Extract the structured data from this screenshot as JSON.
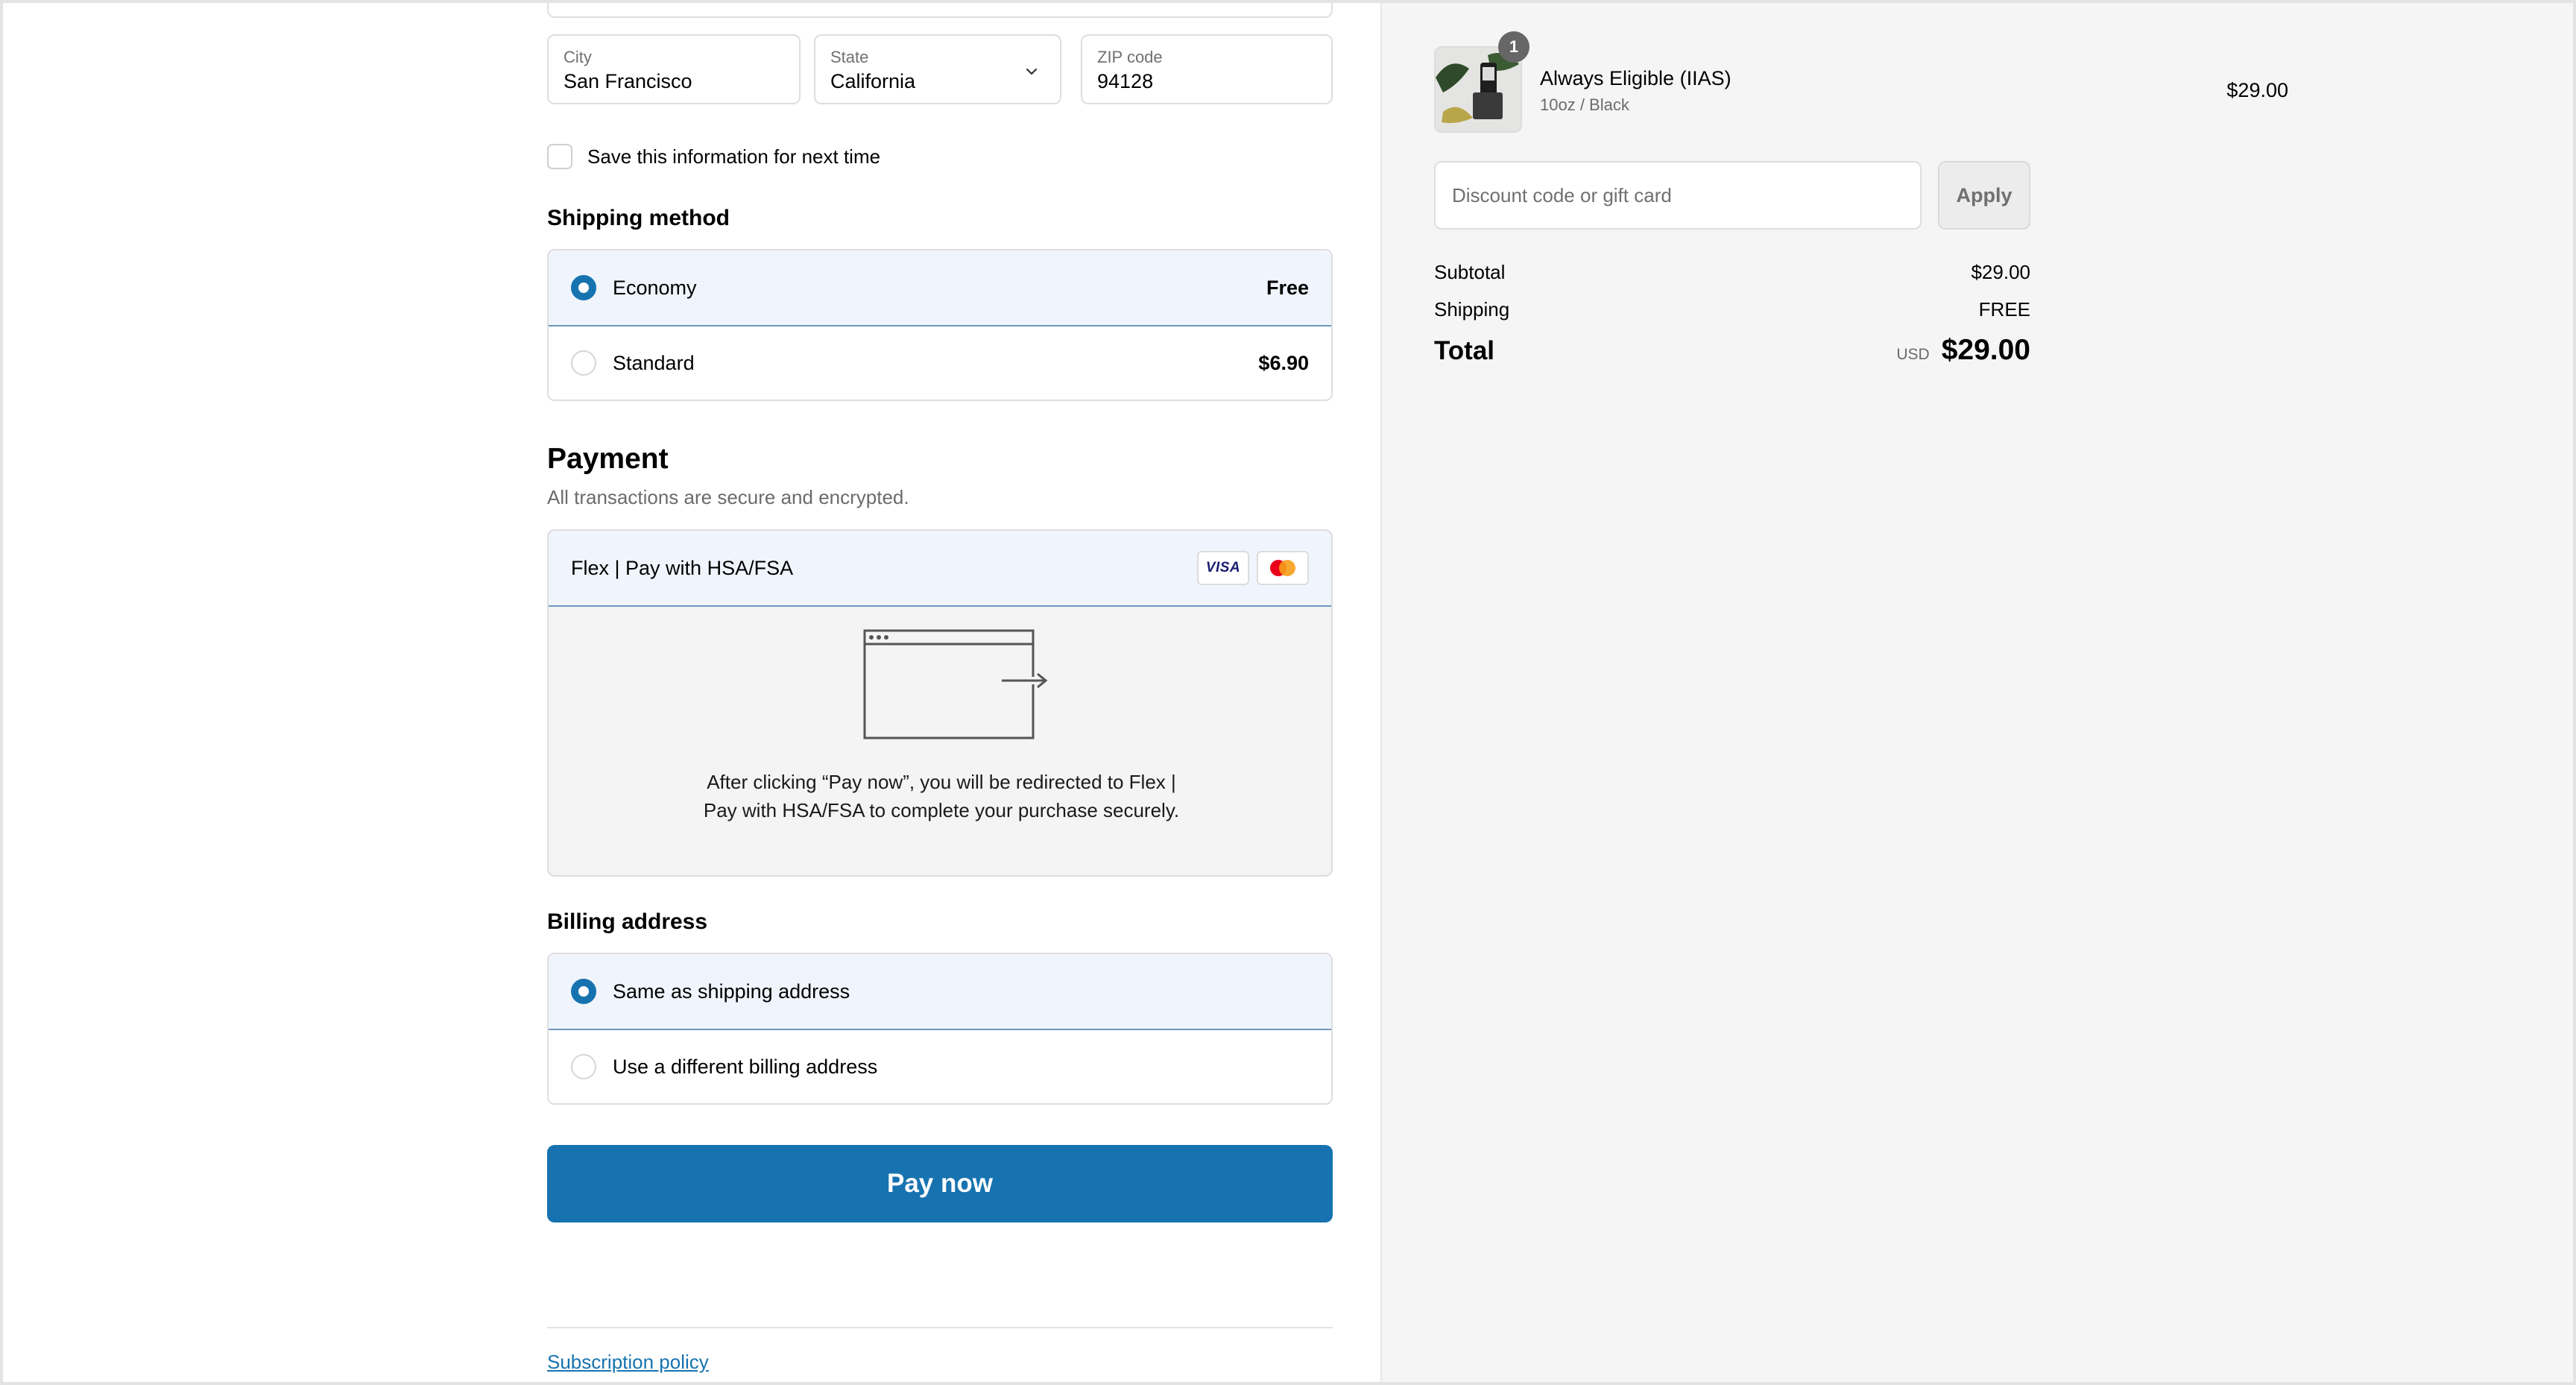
{
  "address": {
    "city": {
      "label": "City",
      "value": "San Francisco"
    },
    "state": {
      "label": "State",
      "value": "California"
    },
    "zip": {
      "label": "ZIP code",
      "value": "94128"
    },
    "save_label": "Save this information for next time"
  },
  "shipping": {
    "title": "Shipping method",
    "options": [
      {
        "label": "Economy",
        "price": "Free",
        "selected": true
      },
      {
        "label": "Standard",
        "price": "$6.90",
        "selected": false
      }
    ]
  },
  "payment": {
    "title": "Payment",
    "subtitle": "All transactions are secure and encrypted.",
    "method": "Flex | Pay with HSA/FSA",
    "visa": "VISA",
    "redirect_text": "After clicking “Pay now”, you will be redirected to Flex | Pay with HSA/FSA to complete your purchase securely."
  },
  "billing": {
    "title": "Billing address",
    "options": [
      {
        "label": "Same as shipping address",
        "selected": true
      },
      {
        "label": "Use a different billing address",
        "selected": false
      }
    ]
  },
  "pay_button": "Pay now",
  "footer": {
    "policy_link": "Subscription policy"
  },
  "summary": {
    "product": {
      "qty": "1",
      "name": "Always Eligible (IIAS)",
      "variant": "10oz / Black",
      "price": "$29.00"
    },
    "discount_placeholder": "Discount code or gift card",
    "apply_label": "Apply",
    "subtotal_label": "Subtotal",
    "subtotal_value": "$29.00",
    "shipping_label": "Shipping",
    "shipping_value": "FREE",
    "total_label": "Total",
    "currency": "USD",
    "total_value": "$29.00"
  },
  "colors": {
    "accent": "#1773b0",
    "selected_bg": "#f0f5fd",
    "summary_bg": "#f5f5f5"
  }
}
